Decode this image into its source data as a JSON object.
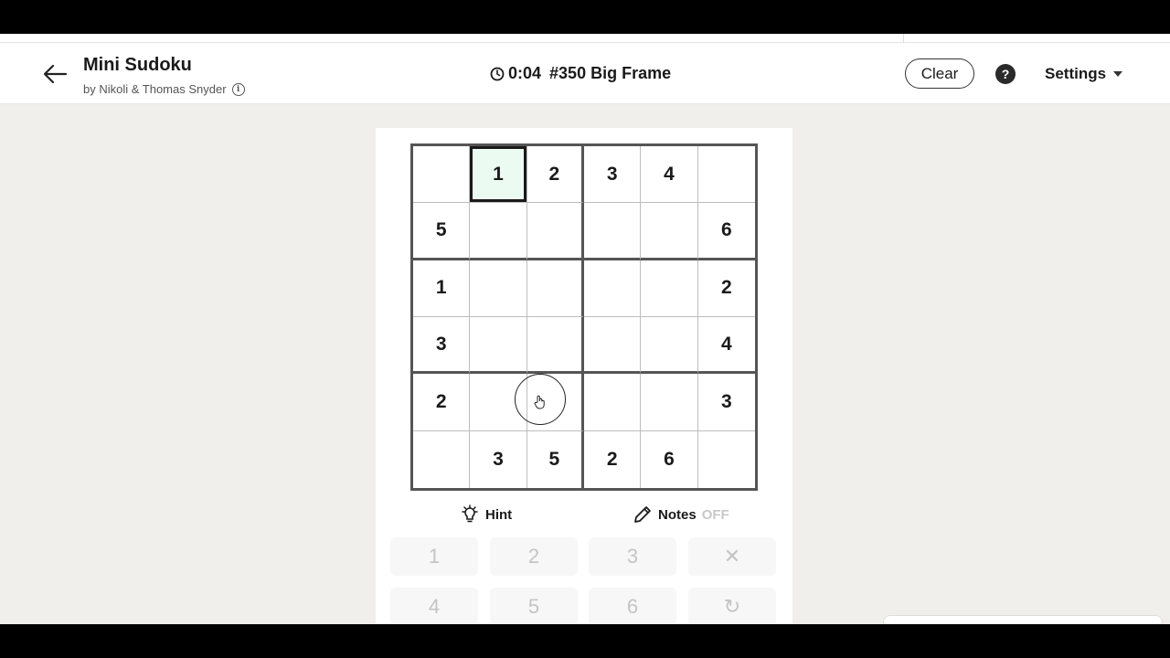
{
  "header": {
    "title": "Mini Sudoku",
    "byline": "by Nikoli & Thomas Snyder",
    "info_glyph": "i",
    "timer": "0:04",
    "puzzle_label": "#350 Big Frame",
    "clear_label": "Clear",
    "help_glyph": "?",
    "settings_label": "Settings"
  },
  "grid": {
    "rows": [
      [
        "",
        "1",
        "2",
        "3",
        "4",
        ""
      ],
      [
        "5",
        "",
        "",
        "",
        "",
        "6"
      ],
      [
        "1",
        "",
        "",
        "",
        "",
        "2"
      ],
      [
        "3",
        "",
        "",
        "",
        "",
        "4"
      ],
      [
        "2",
        "",
        "",
        "",
        "",
        "3"
      ],
      [
        "",
        "3",
        "5",
        "2",
        "6",
        ""
      ]
    ],
    "selected_cell": [
      0,
      1
    ],
    "selected_color": "#ecfbf1"
  },
  "tools": {
    "hint_label": "Hint",
    "notes_label": "Notes",
    "notes_state": "OFF"
  },
  "keypad": [
    {
      "label": "1"
    },
    {
      "label": "2"
    },
    {
      "label": "3"
    },
    {
      "label": "✕",
      "icon": "erase-icon"
    },
    {
      "label": "4"
    },
    {
      "label": "5"
    },
    {
      "label": "6"
    },
    {
      "label": "↻",
      "icon": "undo-icon"
    }
  ],
  "icons": [
    "back-arrow-icon",
    "clock-icon",
    "info-icon",
    "help-icon",
    "chevron-down-icon",
    "lightbulb-icon",
    "pencil-icon",
    "hand-cursor-icon"
  ]
}
